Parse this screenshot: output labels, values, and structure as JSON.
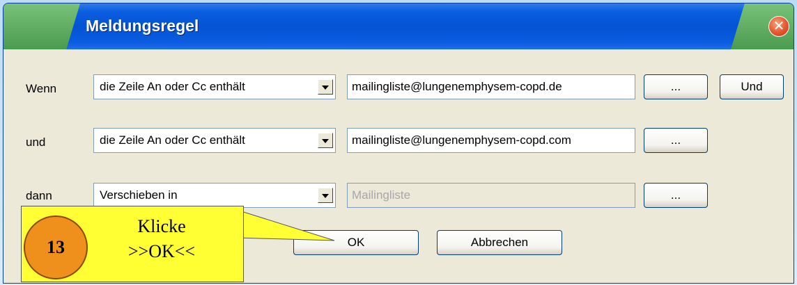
{
  "dialog": {
    "title": "Meldungsregel",
    "close_symbol": "✕"
  },
  "rows": [
    {
      "label": "Wenn",
      "condition": "die Zeile An oder Cc enthält",
      "value": "mailingliste@lungenemphysem-copd.de",
      "browse_label": "...",
      "and_label": "Und"
    },
    {
      "label": "und",
      "condition": "die Zeile An oder Cc enthält",
      "value": "mailingliste@lungenemphysem-copd.com",
      "browse_label": "..."
    },
    {
      "label": "dann",
      "condition": "Verschieben in",
      "value": "Mailingliste",
      "value_disabled": true,
      "browse_label": "..."
    }
  ],
  "buttons": {
    "ok": "OK",
    "cancel": "Abbrechen"
  },
  "callout": {
    "step_number": "13",
    "line1": "Klicke",
    "line2": ">>OK<<"
  },
  "colors": {
    "titlebar": "#0553d4",
    "dialog_bg": "#ece9d8",
    "callout_bg": "#ffff33",
    "step_circle": "#f0901c"
  }
}
